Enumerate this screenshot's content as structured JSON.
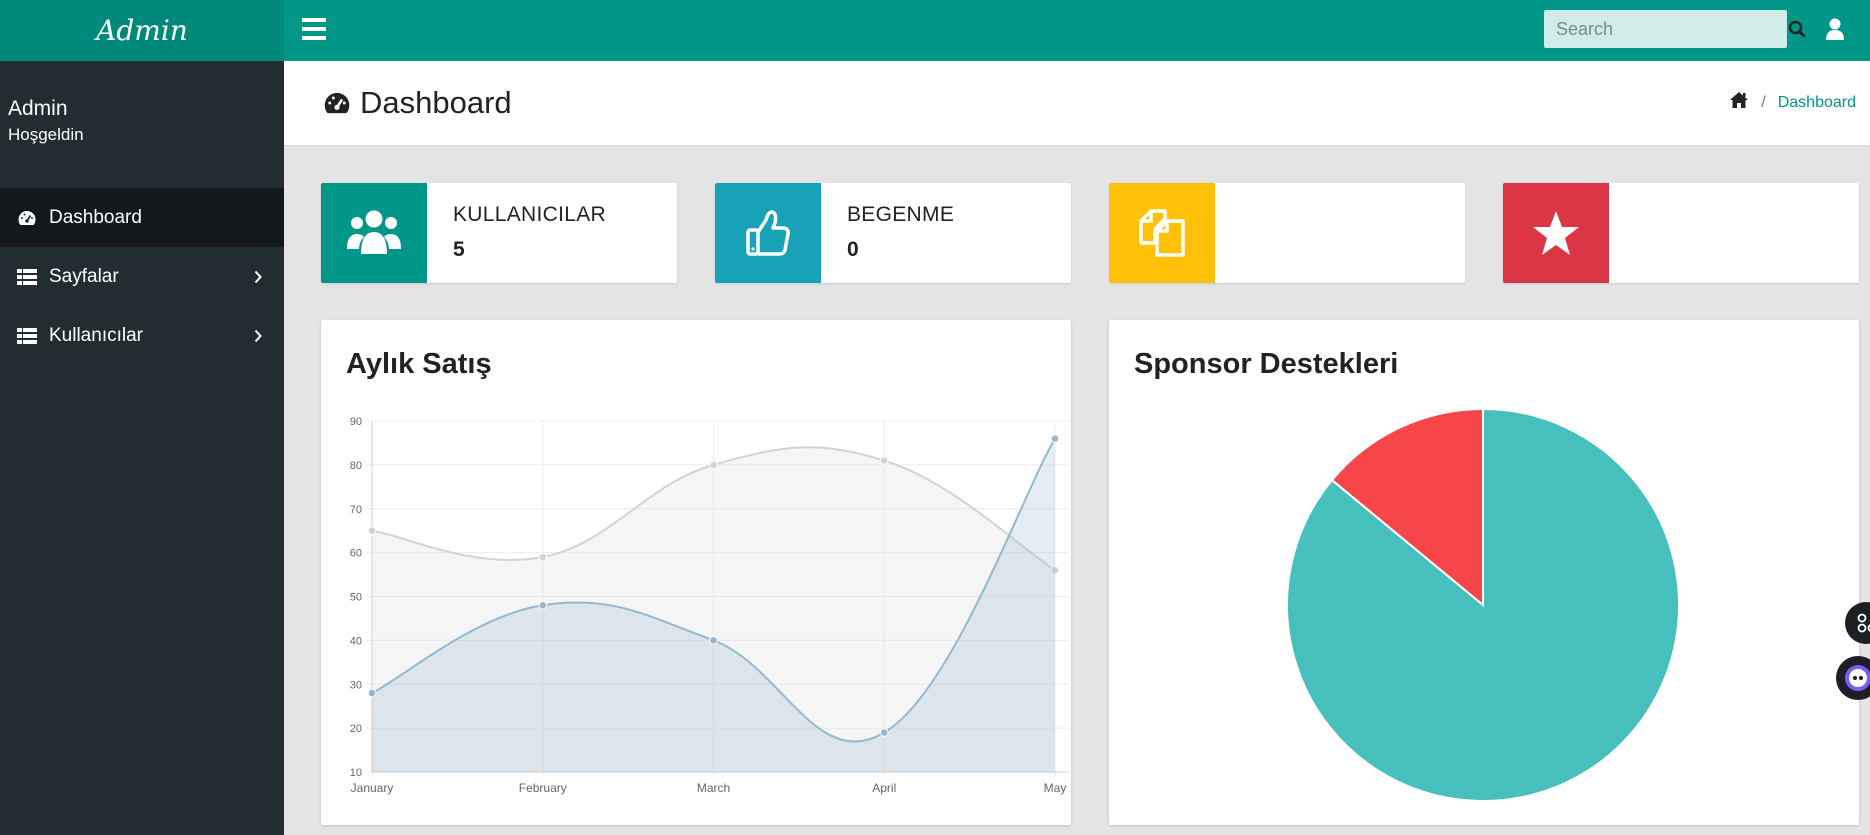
{
  "brand": {
    "title": "Admin"
  },
  "topbar": {
    "search": {
      "placeholder": "Search",
      "value": ""
    },
    "icons": [
      "hamburger-icon",
      "search-icon",
      "user-icon"
    ]
  },
  "sidebar": {
    "user": {
      "name": "Admin",
      "greeting": "Hoşgeldin"
    },
    "items": [
      {
        "label": "Dashboard",
        "icon": "dashboard-icon",
        "active": true
      },
      {
        "label": "Sayfalar",
        "icon": "table-list-icon",
        "active": false
      },
      {
        "label": "Kullanıcılar",
        "icon": "table-list-icon",
        "active": false
      }
    ]
  },
  "header": {
    "title": "Dashboard",
    "breadcrumb": {
      "separator": "/",
      "current": "Dashboard"
    }
  },
  "cards": [
    {
      "label": "KULLANICILAR",
      "value": "5",
      "color": "#009688",
      "icon": "users-icon"
    },
    {
      "label": "BEGENME",
      "value": "0",
      "color": "#17a2b8",
      "icon": "thumbs-up-icon"
    },
    {
      "label": "",
      "value": "",
      "color": "#ffc107",
      "icon": "copy-icon"
    },
    {
      "label": "",
      "value": "",
      "color": "#dc3545",
      "icon": "star-icon"
    }
  ],
  "panels": {
    "line_title": "Aylık Satış",
    "pie_title": "Sponsor Destekleri"
  },
  "chart_data": [
    {
      "type": "line",
      "title": "Aylık Satış",
      "categories": [
        "January",
        "February",
        "March",
        "April",
        "May"
      ],
      "series": [
        {
          "values": [
            65,
            59,
            80,
            81,
            56
          ],
          "color": "#d3d3d3"
        },
        {
          "values": [
            28,
            48,
            40,
            19,
            86
          ],
          "color": "#92b9cf"
        }
      ],
      "ylim": [
        10,
        90
      ],
      "yticks": [
        10,
        20,
        30,
        40,
        50,
        60,
        70,
        80,
        90
      ],
      "grid": true
    },
    {
      "type": "pie",
      "title": "Sponsor Destekleri",
      "values": [
        86,
        14
      ],
      "colors": [
        "#46bfbd",
        "#f7464a"
      ]
    }
  ]
}
